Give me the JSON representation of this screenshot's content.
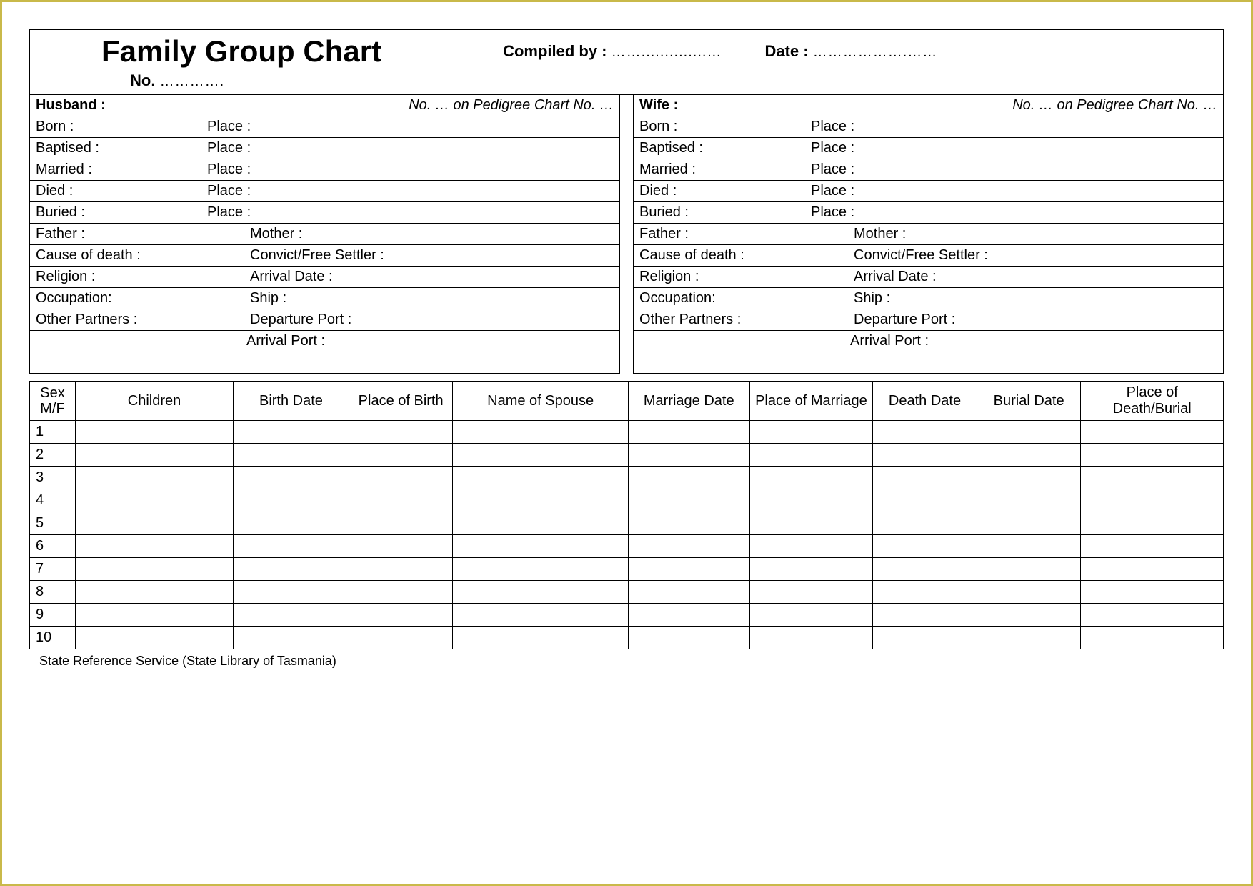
{
  "header": {
    "title": "Family Group Chart",
    "compiled_by_label": "Compiled by :",
    "compiled_by_dots": "……..............…",
    "date_label": "Date :",
    "date_dots": "……………….……",
    "no_label": "No.",
    "no_dots": "…………."
  },
  "husband": {
    "head_label": "Husband :",
    "pedigree": "No. …  on Pedigree Chart No.  …",
    "rows": {
      "born": "Born :",
      "born_place": "Place :",
      "baptised": "Baptised :",
      "baptised_place": "Place :",
      "married": "Married :",
      "married_place": "Place :",
      "died": "Died :",
      "died_place": "Place :",
      "buried": "Buried :",
      "buried_place": "Place :",
      "father": "Father :",
      "mother": "Mother :",
      "cause": "Cause of death :",
      "settler": "Convict/Free Settler :",
      "religion": "Religion :",
      "arrival_date": "Arrival Date :",
      "occupation": "Occupation:",
      "ship": "Ship :",
      "partners": "Other Partners :",
      "departure": "Departure Port :",
      "arrival_port": "Arrival Port :"
    }
  },
  "wife": {
    "head_label": "Wife :",
    "pedigree": "No. …  on Pedigree Chart No.  …",
    "rows": {
      "born": "Born :",
      "born_place": "Place :",
      "baptised": "Baptised :",
      "baptised_place": "Place :",
      "married": "Married :",
      "married_place": "Place :",
      "died": "Died :",
      "died_place": "Place :",
      "buried": "Buried :",
      "buried_place": "Place :",
      "father": "Father :",
      "mother": "Mother :",
      "cause": "Cause of death :",
      "settler": "Convict/Free Settler :",
      "religion": "Religion :",
      "arrival_date": "Arrival Date :",
      "occupation": "Occupation:",
      "ship": "Ship :",
      "partners": "Other Partners :",
      "departure": "Departure Port :",
      "arrival_port": "Arrival Port :"
    }
  },
  "children_headers": {
    "sex": "Sex M/F",
    "children": "Children",
    "birth_date": "Birth Date",
    "place_of_birth": "Place of Birth",
    "spouse": "Name of Spouse",
    "marriage_date": "Marriage Date",
    "place_of_marriage": "Place of Marriage",
    "death_date": "Death Date",
    "burial_date": "Burial Date",
    "place_of_db": "Place of Death/Burial"
  },
  "children_rows": [
    "1",
    "2",
    "3",
    "4",
    "5",
    "6",
    "7",
    "8",
    "9",
    "10"
  ],
  "footer": "State Reference Service   (State Library of Tasmania)"
}
